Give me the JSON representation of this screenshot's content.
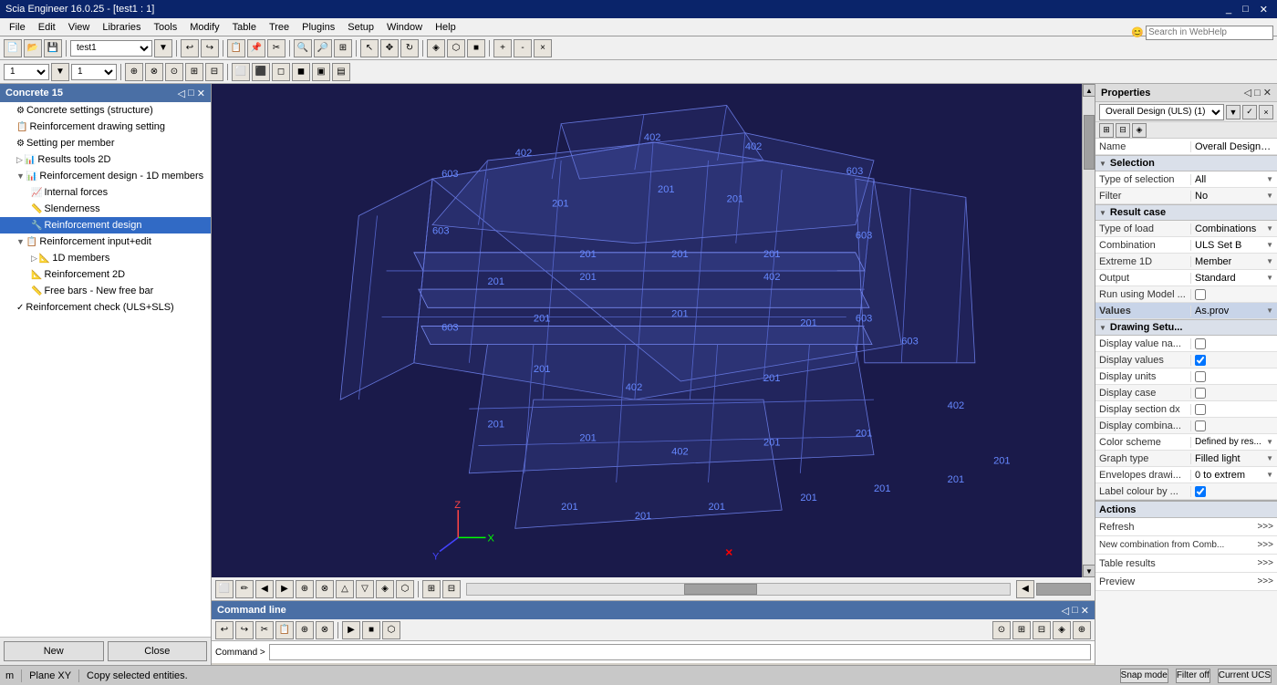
{
  "titlebar": {
    "title": "Scia Engineer 16.0.25 - [test1 : 1]",
    "controls": [
      "_",
      "□",
      "✕"
    ]
  },
  "menubar": {
    "items": [
      "File",
      "Edit",
      "View",
      "Libraries",
      "Tools",
      "Modify",
      "Table",
      "Tree",
      "Plugins",
      "Setup",
      "Window",
      "Help"
    ]
  },
  "toolbar1": {
    "combo_value": "test1",
    "webhelp_placeholder": "Search in WebHelp"
  },
  "left_panel": {
    "title": "Concrete 15",
    "items": [
      {
        "label": "Concrete settings (structure)",
        "level": 1,
        "icon": "⚙",
        "expand": ""
      },
      {
        "label": "Reinforcement drawing setting",
        "level": 1,
        "icon": "📋",
        "expand": ""
      },
      {
        "label": "Setting per member",
        "level": 1,
        "icon": "⚙",
        "expand": ""
      },
      {
        "label": "Results tools 2D",
        "level": 1,
        "icon": "📊",
        "expand": "►"
      },
      {
        "label": "Reinforcement design - 1D members",
        "level": 1,
        "icon": "📊",
        "expand": "►"
      },
      {
        "label": "Internal forces",
        "level": 2,
        "icon": "📈",
        "expand": ""
      },
      {
        "label": "Slenderness",
        "level": 2,
        "icon": "📏",
        "expand": ""
      },
      {
        "label": "Reinforcement design",
        "level": 2,
        "icon": "🔧",
        "expand": "",
        "selected": true
      },
      {
        "label": "Reinforcement input+edit",
        "level": 1,
        "icon": "📋",
        "expand": "►"
      },
      {
        "label": "1D members",
        "level": 2,
        "icon": "📐",
        "expand": "►"
      },
      {
        "label": "Reinforcement 2D",
        "level": 2,
        "icon": "📐",
        "expand": ""
      },
      {
        "label": "Free bars - New free bar",
        "level": 2,
        "icon": "📏",
        "expand": ""
      },
      {
        "label": "Reinforcement check (ULS+SLS)",
        "level": 1,
        "icon": "✓",
        "expand": ""
      }
    ],
    "footer_buttons": [
      "New",
      "Close"
    ]
  },
  "properties_panel": {
    "title": "Properties",
    "dropdown_value": "Overall Design (ULS) (1)",
    "name_label": "Name",
    "name_value": "Overall Design (...",
    "sections": [
      {
        "label": "Selection",
        "rows": [
          {
            "label": "Type of selection",
            "value": "All",
            "type": "dropdown"
          },
          {
            "label": "Filter",
            "value": "No",
            "type": "dropdown"
          }
        ]
      },
      {
        "label": "Result case",
        "rows": [
          {
            "label": "Type of load",
            "value": "Combinations",
            "type": "dropdown"
          },
          {
            "label": "Combination",
            "value": "ULS Set B",
            "type": "dropdown"
          },
          {
            "label": "Extreme 1D",
            "value": "Member",
            "type": "dropdown"
          },
          {
            "label": "Output",
            "value": "Standard",
            "type": "dropdown"
          },
          {
            "label": "Run using Model ...",
            "value": "",
            "type": "checkbox",
            "checked": false
          },
          {
            "label": "Values",
            "value": "As.prov",
            "type": "dropdown"
          }
        ]
      },
      {
        "label": "Drawing Setu...",
        "rows": [
          {
            "label": "Display value na...",
            "value": "",
            "type": "checkbox",
            "checked": false
          },
          {
            "label": "Display values",
            "value": "",
            "type": "checkbox",
            "checked": true
          },
          {
            "label": "Display units",
            "value": "",
            "type": "checkbox",
            "checked": false
          },
          {
            "label": "Display case",
            "value": "",
            "type": "checkbox",
            "checked": false
          },
          {
            "label": "Display section dx",
            "value": "",
            "type": "checkbox",
            "checked": false
          },
          {
            "label": "Display combina...",
            "value": "",
            "type": "checkbox",
            "checked": false
          },
          {
            "label": "Color scheme",
            "value": "Defined by res...",
            "type": "dropdown"
          },
          {
            "label": "Graph type",
            "value": "Filled light",
            "type": "dropdown"
          },
          {
            "label": "Envelopes drawi...",
            "value": "0 to extrem",
            "type": "dropdown"
          },
          {
            "label": "Label colour by ...",
            "value": "",
            "type": "checkbox",
            "checked": true
          }
        ]
      }
    ],
    "actions": {
      "label": "Actions",
      "items": [
        {
          "label": "Refresh",
          "arrow": ">>>"
        },
        {
          "label": "New combination from Comb...",
          "arrow": ">>>"
        },
        {
          "label": "Table results",
          "arrow": ">>>"
        },
        {
          "label": "Preview",
          "arrow": ">>>"
        }
      ]
    }
  },
  "statusbar": {
    "mode": "m",
    "plane": "Plane XY",
    "message": "Copy selected entities.",
    "snap_mode": "Snap mode",
    "filter_off": "Filter off",
    "current_ucs": "Current UCS"
  },
  "command_panel": {
    "title": "Command line",
    "prompt": "Command >"
  },
  "viewport": {
    "bg_color": "#1a1a4a"
  }
}
